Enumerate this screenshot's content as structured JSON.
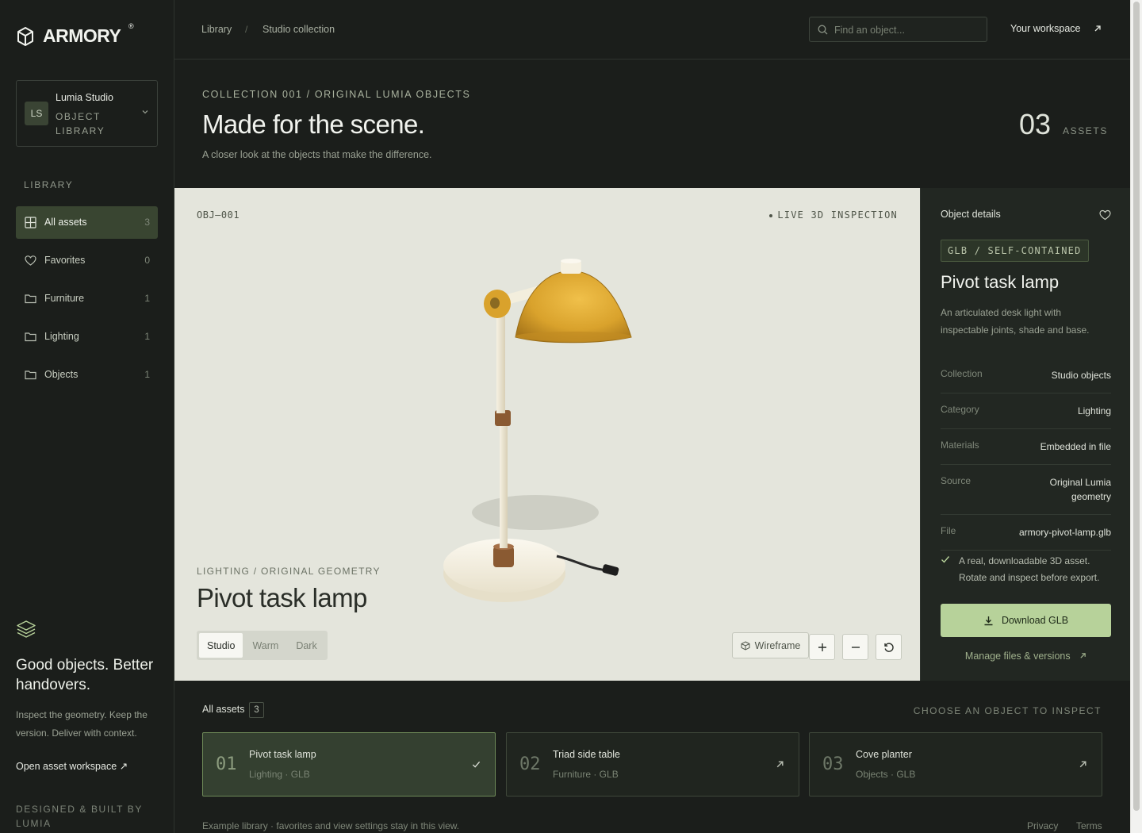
{
  "brand": {
    "name": "ARMORY",
    "reg": "®"
  },
  "workspace": {
    "initials": "LS",
    "name": "Lumia Studio",
    "subtitle": "OBJECT LIBRARY"
  },
  "sidebar": {
    "section_label": "LIBRARY",
    "items": [
      {
        "label": "All assets",
        "count": "3",
        "icon": "grid-icon",
        "active": true
      },
      {
        "label": "Favorites",
        "count": "0",
        "icon": "heart-icon"
      },
      {
        "label": "Furniture",
        "count": "1",
        "icon": "folder-icon"
      },
      {
        "label": "Lighting",
        "count": "1",
        "icon": "folder-icon"
      },
      {
        "label": "Objects",
        "count": "1",
        "icon": "folder-icon"
      }
    ],
    "promo": {
      "headline": "Good objects. Better handovers.",
      "body": "Inspect the geometry. Keep the version. Deliver with context.",
      "link": "Open asset workspace ↗"
    },
    "credit": "DESIGNED & BUILT BY LUMIA"
  },
  "topbar": {
    "breadcrumb": [
      "Library",
      "Studio collection"
    ],
    "breadcrumb_sep": "/",
    "search_placeholder": "Find an object...",
    "workspace_link": "Your workspace"
  },
  "header": {
    "eyebrow": "COLLECTION 001 / ORIGINAL LUMIA OBJECTS",
    "title": "Made for the scene.",
    "subtitle": "A closer look at the objects that make the difference.",
    "asset_count": "03",
    "asset_label": "ASSETS"
  },
  "viewer": {
    "object_id": "OBJ—001",
    "live_label": "LIVE 3D INSPECTION",
    "eyebrow": "LIGHTING / ORIGINAL GEOMETRY",
    "title": "Pivot task lamp",
    "environments": [
      "Studio",
      "Warm",
      "Dark"
    ],
    "active_environment": "Studio",
    "wireframe_label": "Wireframe",
    "colors": {
      "shade": "#d9a22c",
      "body": "#efe9d6",
      "joint": "#8a5a32"
    }
  },
  "details": {
    "heading": "Object details",
    "badge": "GLB / SELF-CONTAINED",
    "title": "Pivot task lamp",
    "description": "An articulated desk light with inspectable joints, shade and base.",
    "rows": [
      {
        "key": "Collection",
        "value": "Studio objects"
      },
      {
        "key": "Category",
        "value": "Lighting"
      },
      {
        "key": "Materials",
        "value": "Embedded in file"
      },
      {
        "key": "Source",
        "value": "Original Lumia geometry"
      },
      {
        "key": "File",
        "value": "armory-pivot-lamp.glb"
      }
    ],
    "note": "A real, downloadable 3D asset. Rotate and inspect before export.",
    "download_label": "Download GLB",
    "manage_label": "Manage files & versions"
  },
  "assets": {
    "label": "All assets",
    "count": "3",
    "hint": "CHOOSE AN OBJECT TO INSPECT",
    "cards": [
      {
        "num": "01",
        "name": "Pivot task lamp",
        "meta": "Lighting · GLB",
        "active": true
      },
      {
        "num": "02",
        "name": "Triad side table",
        "meta": "Furniture · GLB"
      },
      {
        "num": "03",
        "name": "Cove planter",
        "meta": "Objects · GLB"
      }
    ]
  },
  "footer": {
    "note": "Example library · favorites and view settings stay in this view.",
    "links": [
      "Privacy",
      "Terms"
    ]
  },
  "accent": "#b7d29a"
}
